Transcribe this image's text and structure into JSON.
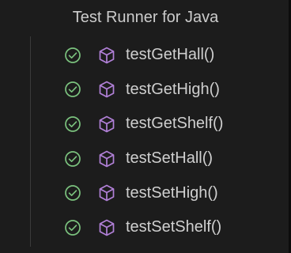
{
  "header": {
    "title": "Test Runner for Java"
  },
  "colors": {
    "pass": "#7bc27e",
    "method": "#b180d7",
    "text": "#cfcfcf"
  },
  "tests": [
    {
      "label": "testGetHall()",
      "status": "passed",
      "status_icon": "check-circle-icon",
      "type_icon": "method-cube-icon"
    },
    {
      "label": "testGetHigh()",
      "status": "passed",
      "status_icon": "check-circle-icon",
      "type_icon": "method-cube-icon"
    },
    {
      "label": "testGetShelf()",
      "status": "passed",
      "status_icon": "check-circle-icon",
      "type_icon": "method-cube-icon"
    },
    {
      "label": "testSetHall()",
      "status": "passed",
      "status_icon": "check-circle-icon",
      "type_icon": "method-cube-icon"
    },
    {
      "label": "testSetHigh()",
      "status": "passed",
      "status_icon": "check-circle-icon",
      "type_icon": "method-cube-icon"
    },
    {
      "label": "testSetShelf()",
      "status": "passed",
      "status_icon": "check-circle-icon",
      "type_icon": "method-cube-icon"
    }
  ]
}
